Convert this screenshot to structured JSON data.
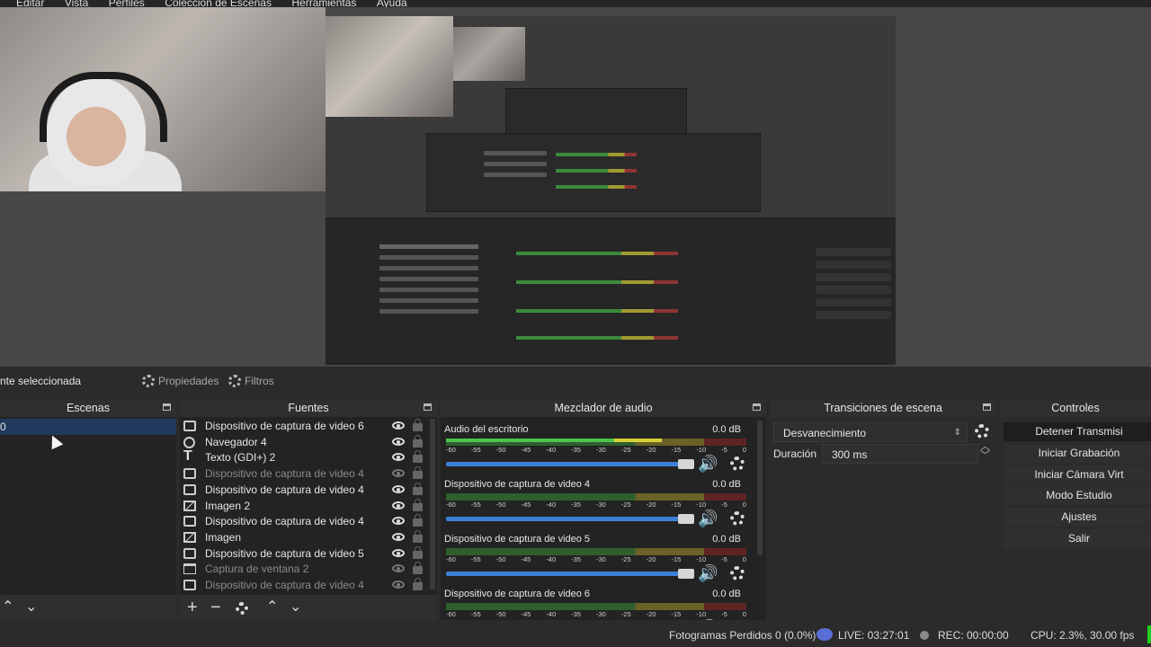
{
  "menu": [
    "Editar",
    "Vista",
    "Perfiles",
    "Colección de Escenas",
    "Herramientas",
    "Ayuda"
  ],
  "scene_bar": {
    "no_source": "nte seleccionada",
    "properties": "Propiedades",
    "filters": "Filtros"
  },
  "scenes": {
    "title": "Escenas",
    "items": [
      {
        "label": "0"
      }
    ]
  },
  "sources": {
    "title": "Fuentes",
    "items": [
      {
        "label": "Dispositivo de captura de video 6",
        "icon": "camera-icon",
        "visible": true
      },
      {
        "label": "Navegador 4",
        "icon": "globe-icon",
        "visible": true
      },
      {
        "label": "Texto (GDI+) 2",
        "icon": "text-icon",
        "visible": true
      },
      {
        "label": "Dispositivo de captura de video 4",
        "icon": "camera-icon",
        "visible": false
      },
      {
        "label": "Dispositivo de captura de video 4",
        "icon": "camera-icon",
        "visible": true
      },
      {
        "label": "Imagen 2",
        "icon": "image-icon",
        "visible": true
      },
      {
        "label": "Dispositivo de captura de video 4",
        "icon": "camera-icon",
        "visible": true
      },
      {
        "label": "Imagen",
        "icon": "image-icon",
        "visible": true
      },
      {
        "label": "Dispositivo de captura de video 5",
        "icon": "camera-icon",
        "visible": true
      },
      {
        "label": "Captura de ventana 2",
        "icon": "window-icon",
        "visible": false
      },
      {
        "label": "Dispositivo de captura de video 4",
        "icon": "camera-icon",
        "visible": false
      }
    ]
  },
  "mixer": {
    "title": "Mezclador de audio",
    "ticks": [
      "-60",
      "-55",
      "-50",
      "-45",
      "-40",
      "-35",
      "-30",
      "-25",
      "-20",
      "-15",
      "-10",
      "-5",
      "0"
    ],
    "channels": [
      {
        "name": "Audio del escritorio",
        "db": "0.0 dB",
        "level": 0.72
      },
      {
        "name": "Dispositivo de captura de video 4",
        "db": "0.0 dB",
        "level": 0.0
      },
      {
        "name": "Dispositivo de captura de video 5",
        "db": "0.0 dB",
        "level": 0.0
      },
      {
        "name": "Dispositivo de captura de video 6",
        "db": "0.0 dB",
        "level": 0.0
      }
    ]
  },
  "transitions": {
    "title": "Transiciones de escena",
    "selected": "Desvanecimiento",
    "duration_label": "Duración",
    "duration_value": "300 ms"
  },
  "controls": {
    "title": "Controles",
    "buttons": [
      "Detener Transmisi",
      "Iniciar Grabación",
      "Iniciar Cámara Virt",
      "Modo Estudio",
      "Ajustes",
      "Salir"
    ]
  },
  "status": {
    "dropped": "Fotogramas Perdidos 0 (0.0%)",
    "live": "LIVE: 03:27:01",
    "rec": "REC: 00:00:00",
    "cpu": "CPU: 2.3%, 30.00 fps"
  },
  "colors": {
    "accent": "#3c80d6",
    "live_icon": "#5a6fd6",
    "status_ok": "#1fd11f"
  }
}
